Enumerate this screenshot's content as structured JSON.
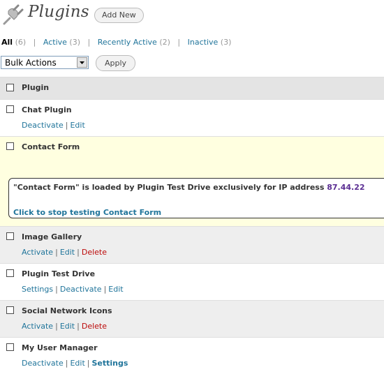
{
  "header": {
    "title": "Plugins",
    "add_new": "Add New"
  },
  "views": [
    {
      "label": "All",
      "count": "(6)"
    },
    {
      "label": "Active",
      "count": "(3)"
    },
    {
      "label": "Recently Active",
      "count": "(2)"
    },
    {
      "label": "Inactive",
      "count": "(3)"
    }
  ],
  "bulk": {
    "selected": "Bulk Actions",
    "apply": "Apply"
  },
  "table": {
    "column": "Plugin"
  },
  "plugins": [
    {
      "name": "Chat Plugin",
      "actions": [
        "Deactivate",
        "Edit"
      ]
    },
    {
      "name": "Contact Form"
    },
    {
      "name": "Image Gallery",
      "actions": [
        "Activate",
        "Edit",
        "Delete"
      ]
    },
    {
      "name": "Plugin Test Drive",
      "actions": [
        "Settings",
        "Deactivate",
        "Edit"
      ]
    },
    {
      "name": "Social Network Icons",
      "actions": [
        "Activate",
        "Edit",
        "Delete"
      ]
    },
    {
      "name": "My User Manager",
      "actions": [
        "Deactivate",
        "Edit",
        "Settings"
      ]
    }
  ],
  "notice": {
    "message": "\"Contact Form\" is loaded by Plugin Test Drive exclusively for IP address",
    "ip": "87.44.22",
    "stop_link": "Click to stop testing Contact Form"
  }
}
